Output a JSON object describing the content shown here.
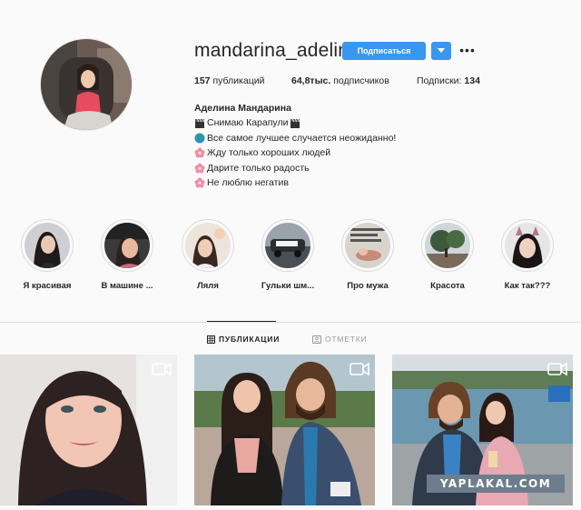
{
  "profile": {
    "username": "mandarina_adelina",
    "follow_label": "Подписаться",
    "dropdown_icon": "chevron-down-icon",
    "more_icon": "more-icon",
    "more_text": "•••"
  },
  "stats": {
    "posts_count": "157",
    "posts_label": "публикаций",
    "followers_count": "64,8тыс.",
    "followers_label": "подписчиков",
    "following_label": "Подписки:",
    "following_count": "134"
  },
  "bio": {
    "name": "Аделина Мандарина",
    "lines": [
      {
        "icon": "clapperboard-icon",
        "text": "Снимаю Карапули"
      },
      {
        "icon": "globe-icon",
        "text": "Все самое лучшее случается неожиданно!"
      },
      {
        "icon": "flower-icon",
        "text": "Жду только хороших людей"
      },
      {
        "icon": "flower-icon",
        "text": "Дарите только радость"
      },
      {
        "icon": "flower-icon",
        "text": "Не люблю негатив"
      }
    ]
  },
  "highlights": [
    {
      "label": "Я красивая"
    },
    {
      "label": "В машине ..."
    },
    {
      "label": "Ляля"
    },
    {
      "label": "Гульки шм..."
    },
    {
      "label": "Про мужа"
    },
    {
      "label": "Красота"
    },
    {
      "label": "Как так???"
    }
  ],
  "tabs": {
    "posts_label": "ПУБЛИКАЦИИ",
    "tagged_label": "ОТМЕТКИ"
  },
  "watermark": "YAPLAKAL.COM",
  "colors": {
    "accent": "#3897f0",
    "background": "#fafafa",
    "text": "#262626",
    "border": "#dbdbdb"
  }
}
